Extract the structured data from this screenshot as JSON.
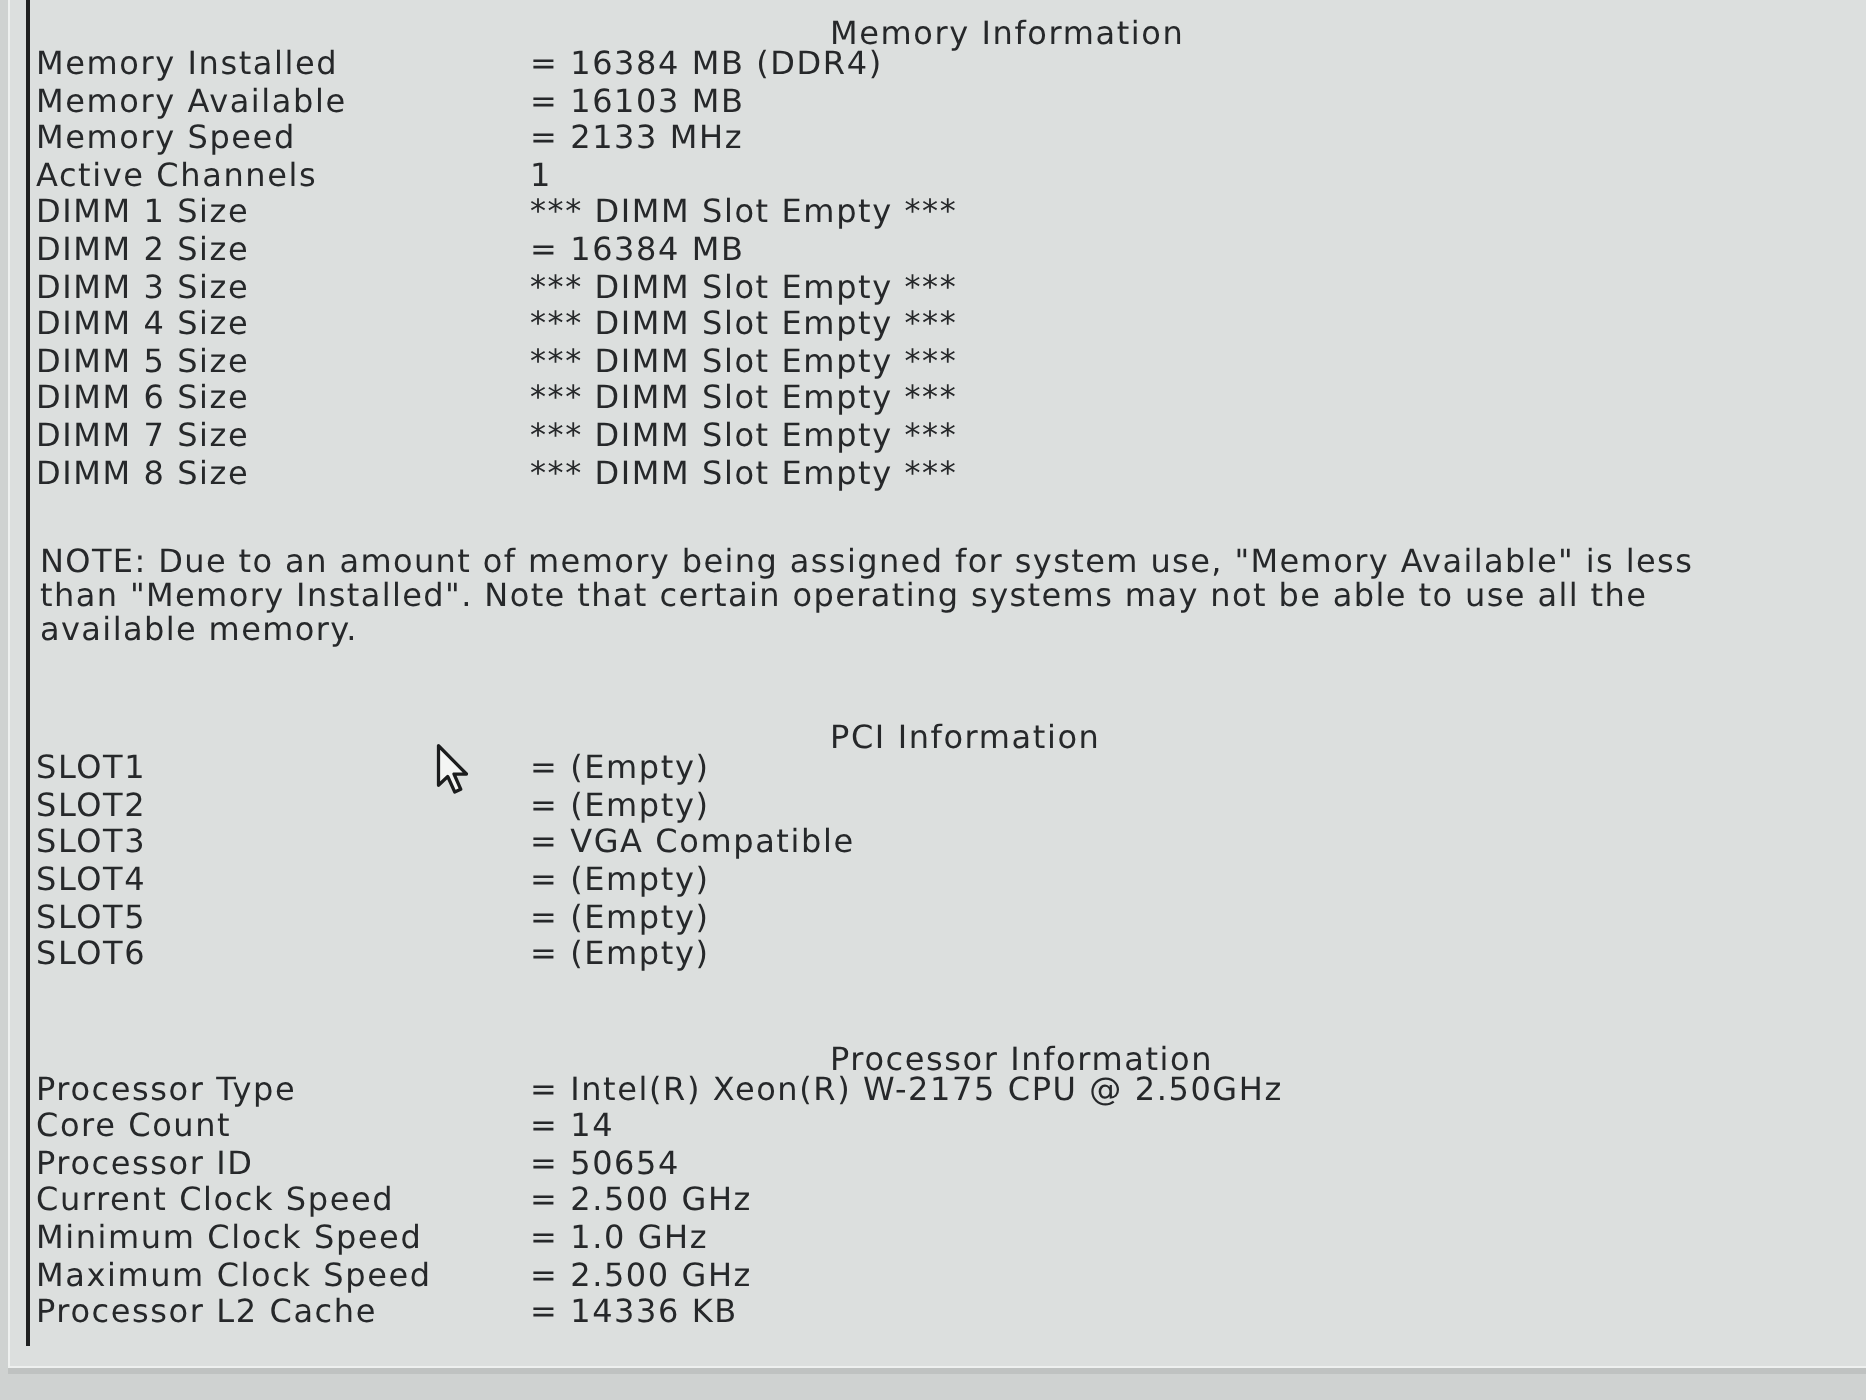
{
  "sections": [
    {
      "title": "Memory Information",
      "rows": [
        {
          "label": "Memory Installed",
          "value": "= 16384 MB (DDR4)"
        },
        {
          "label": "Memory Available",
          "value": "= 16103 MB"
        },
        {
          "label": "Memory Speed",
          "value": "= 2133 MHz"
        },
        {
          "label": "Active Channels",
          "value": "1"
        },
        {
          "label": "DIMM 1 Size",
          "value": "*** DIMM Slot Empty ***"
        },
        {
          "label": "DIMM 2 Size",
          "value": "= 16384 MB"
        },
        {
          "label": "DIMM 3 Size",
          "value": "*** DIMM Slot Empty ***"
        },
        {
          "label": "DIMM 4 Size",
          "value": "*** DIMM Slot Empty ***"
        },
        {
          "label": "DIMM 5 Size",
          "value": "*** DIMM Slot Empty ***"
        },
        {
          "label": "DIMM 6 Size",
          "value": "*** DIMM Slot Empty ***"
        },
        {
          "label": "DIMM 7 Size",
          "value": "*** DIMM Slot Empty ***"
        },
        {
          "label": "DIMM 8 Size",
          "value": "*** DIMM Slot Empty ***"
        }
      ],
      "note": "NOTE: Due to an amount of memory being assigned for system use, \"Memory Available\" is less than \"Memory Installed\". Note that certain operating systems may not be able to use all the available memory."
    },
    {
      "title": "PCI Information",
      "rows": [
        {
          "label": "SLOT1",
          "value": "= (Empty)"
        },
        {
          "label": "SLOT2",
          "value": "= (Empty)"
        },
        {
          "label": "SLOT3",
          "value": "= VGA Compatible"
        },
        {
          "label": "SLOT4",
          "value": "= (Empty)"
        },
        {
          "label": "SLOT5",
          "value": "= (Empty)"
        },
        {
          "label": "SLOT6",
          "value": "= (Empty)"
        }
      ]
    },
    {
      "title": "Processor Information",
      "rows": [
        {
          "label": "Processor Type",
          "value": "= Intel(R) Xeon(R) W-2175 CPU @ 2.50GHz"
        },
        {
          "label": "Core Count",
          "value": "= 14"
        },
        {
          "label": "Processor ID",
          "value": "= 50654"
        },
        {
          "label": "Current Clock Speed",
          "value": "= 2.500 GHz"
        },
        {
          "label": "Minimum Clock Speed",
          "value": "= 1.0 GHz"
        },
        {
          "label": "Maximum Clock Speed",
          "value": "= 2.500 GHz"
        },
        {
          "label": "Processor L2 Cache",
          "value": "= 14336 KB"
        }
      ]
    }
  ]
}
